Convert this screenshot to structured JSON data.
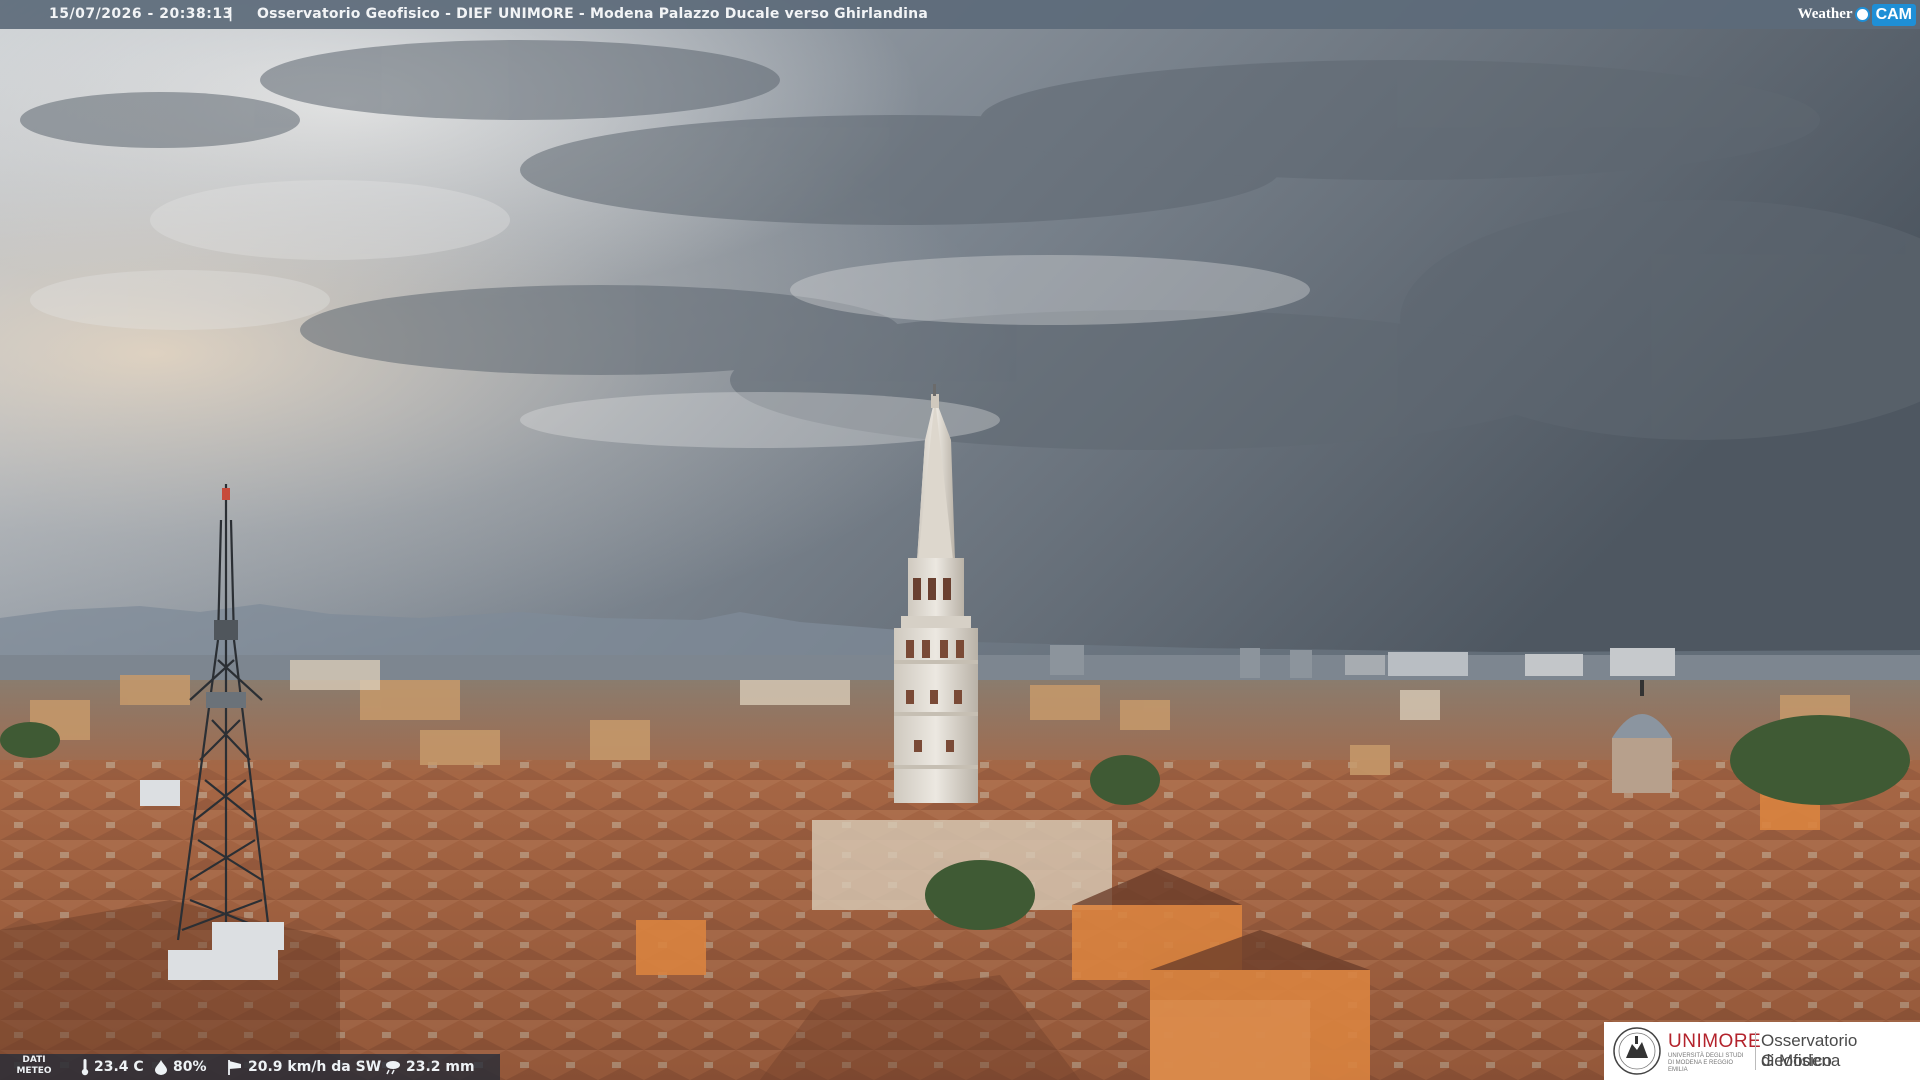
{
  "overlay": {
    "timestamp": "15/07/2026 - 20:38:13",
    "separator": "|",
    "title": "Osservatorio Geofisico - DIEF UNIMORE - Modena Palazzo Ducale verso Ghirlandina",
    "brand_weather": "Weather",
    "brand_cam": "CAM"
  },
  "weather": {
    "label_line1": "DATI",
    "label_line2": "METEO",
    "temperature": "23.4 C",
    "humidity": "80%",
    "wind": "20.9 km/h da SW",
    "rain": "23.2 mm"
  },
  "institution": {
    "name": "UNIMORE",
    "subtitle": "UNIVERSITÀ DEGLI STUDI DI MODENA E REGGIO EMILIA",
    "observatory_line1": "Osservatorio Geofisico",
    "observatory_line2": "di Modena"
  },
  "colors": {
    "topbar": "#5c6a7a",
    "brand_blue": "#1e8fd6",
    "unimore_red": "#b3232c",
    "roofs": "#a9623f",
    "sky_dark": "#4f5862"
  },
  "icons": {
    "temperature": "thermometer-icon",
    "humidity": "droplet-icon",
    "wind": "wind-sock-icon",
    "rain": "rain-icon"
  }
}
